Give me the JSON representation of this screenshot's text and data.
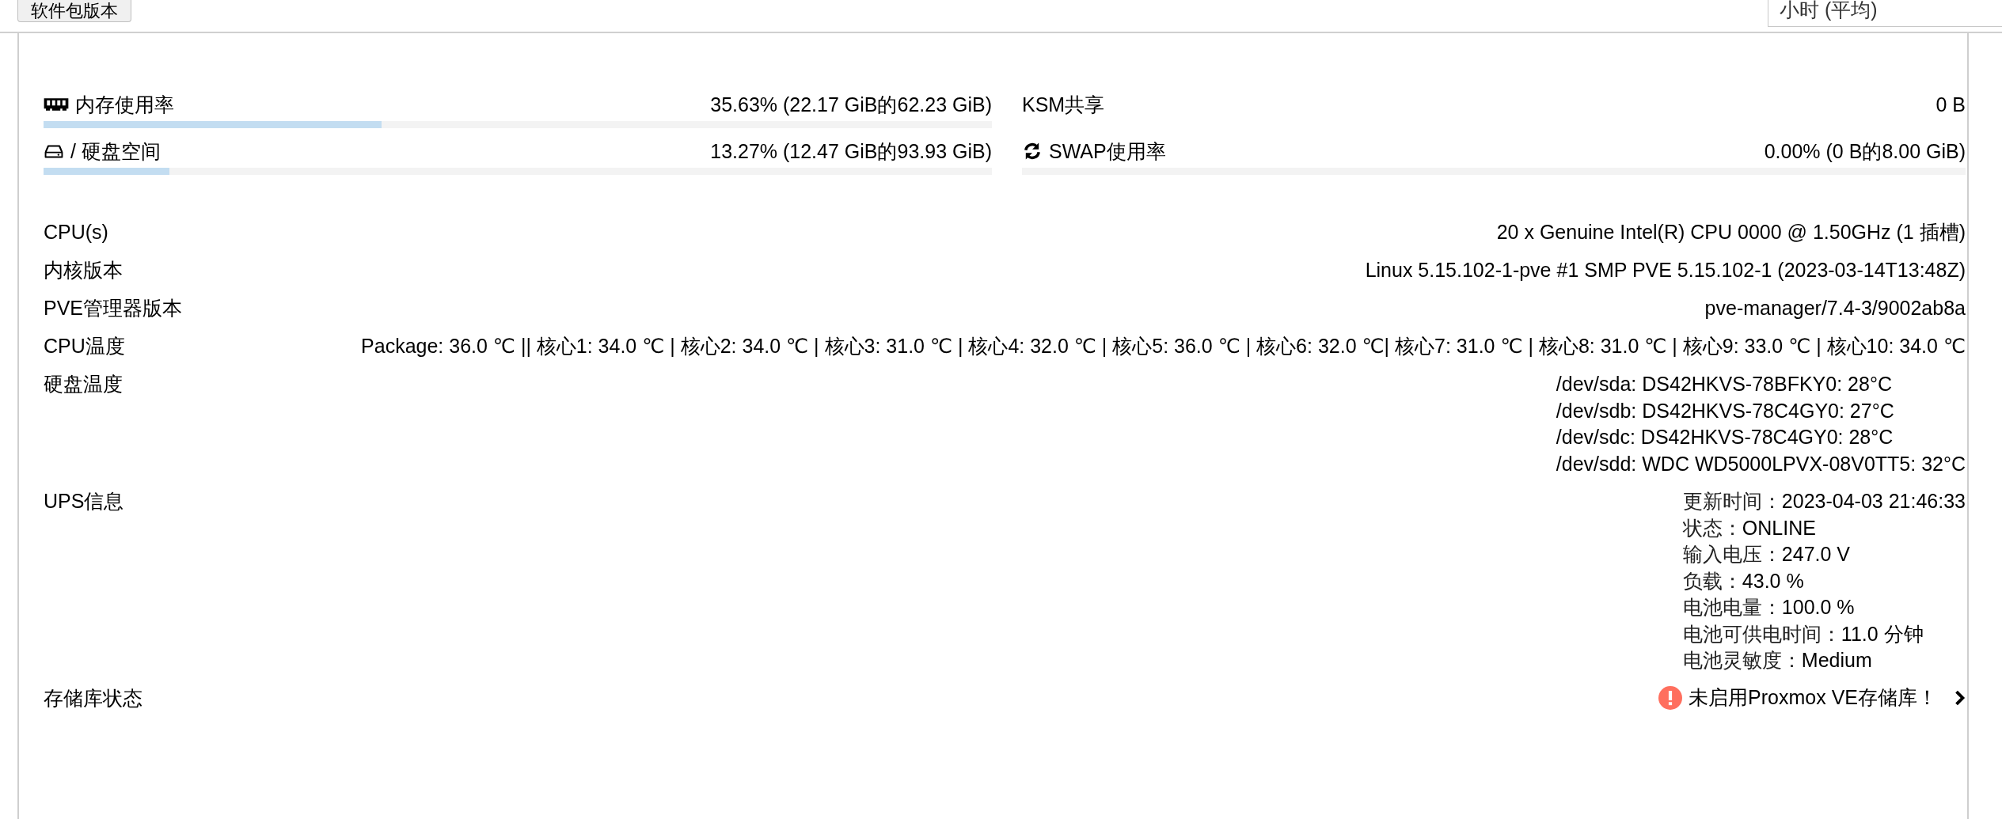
{
  "toolbar": {
    "button": "软件包版本",
    "dropdown": {
      "value": "小时 (平均)"
    }
  },
  "usage": {
    "left": [
      {
        "kind": "bar",
        "label": "内存使用率",
        "value": "35.63% (22.17 GiB的62.23 GiB)",
        "level": 0.3563
      },
      {
        "kind": "bar",
        "label": "/ 硬盘空间",
        "value": "13.27% (12.47 GiB的93.93 GiB)",
        "level": 0.1327
      }
    ],
    "right": [
      {
        "kind": "text",
        "label": "KSM共享",
        "value": "0 B"
      },
      {
        "kind": "bar",
        "label": "SWAP使用率",
        "value": "0.00% (0 B的8.00 GiB)"
      }
    ]
  },
  "info": [
    {
      "kind": "text",
      "label": "CPU(s)",
      "value": "20 x Genuine Intel(R) CPU 0000 @ 1.50GHz (1 插槽)"
    },
    {
      "kind": "text",
      "label": "内核版本",
      "value": "Linux 5.15.102-1-pve #1 SMP PVE 5.15.102-1 (2023-03-14T13:48Z)"
    },
    {
      "kind": "text",
      "label": "PVE管理器版本",
      "value": "pve-manager/7.4-3/9002ab8a"
    },
    {
      "kind": "text",
      "label": "CPU温度",
      "value": "Package: 36.0 ℃ || 核心1: 34.0 ℃ | 核心2: 34.0 ℃ | 核心3: 31.0 ℃ | 核心4: 32.0 ℃ | 核心5: 36.0 ℃ | 核心6: 32.0 ℃| 核心7: 31.0 ℃ | 核心8: 31.0 ℃ | 核心9: 33.0 ℃ | 核心10: 34.0 ℃"
    },
    {
      "kind": "lines",
      "label": "硬盘温度",
      "lines": [
        "/dev/sda: DS42HKVS-78BFKY0: 28°C",
        "/dev/sdb: DS42HKVS-78C4GY0: 27°C",
        "/dev/sdc: DS42HKVS-78C4GY0: 28°C",
        "/dev/sdd: WDC WD5000LPVX-08V0TT5: 32°C"
      ]
    },
    {
      "kind": "pairs",
      "label": "UPS信息",
      "pairs": [
        {
          "label": "更新时间：",
          "value": "2023-04-03 21:46:33"
        },
        {
          "label": "状态：",
          "value": "ONLINE"
        },
        {
          "label": "输入电压：",
          "value": "247.0 V"
        },
        {
          "label": "负载：",
          "value": "43.0 %"
        },
        {
          "label": "电池电量：",
          "value": "100.0 %"
        },
        {
          "label": "电池可供电时间：",
          "value": "11.0 分钟"
        },
        {
          "label": "电池灵敏度：",
          "value": "Medium"
        }
      ]
    },
    {
      "kind": "status",
      "label": "存储库状态",
      "status": "未启用Proxmox VE存储库！"
    }
  ]
}
